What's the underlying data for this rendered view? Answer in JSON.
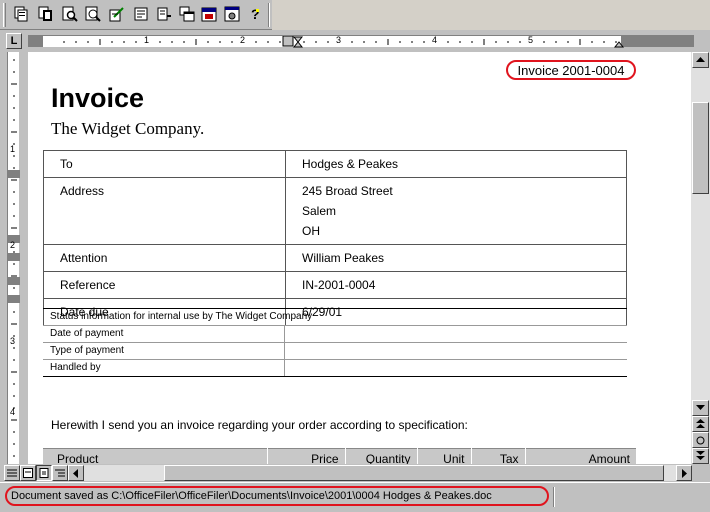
{
  "toolbar": {
    "buttons": [
      "copy-document-icon",
      "new-document-icon",
      "search-document-icon",
      "preview-icon",
      "edit-icon",
      "list-insert-icon",
      "list-remove-icon",
      "copy-window-icon",
      "calendar-icon",
      "settings-icon",
      "help-icon"
    ]
  },
  "ruler": {
    "corner_label": "L",
    "marks": [
      "1",
      "2",
      "3",
      "4",
      "5"
    ],
    "vertical_marks": [
      "1",
      "2",
      "3",
      "4"
    ]
  },
  "document": {
    "invoice_number": "Invoice 2001-0004",
    "title": "Invoice",
    "company": "The Widget Company.",
    "info_rows": [
      {
        "label": "To",
        "value": [
          "Hodges & Peakes"
        ]
      },
      {
        "label": "Address",
        "value": [
          "245 Broad Street",
          "Salem",
          "OH"
        ]
      },
      {
        "label": "Attention",
        "value": [
          "William Peakes"
        ]
      },
      {
        "label": "Reference",
        "value": [
          "IN-2001-0004"
        ]
      },
      {
        "label": "Date due",
        "value": [
          "6/29/01"
        ]
      }
    ],
    "status_header": "Status information for internal use by The Widget Company",
    "status_rows": [
      "Date of payment",
      "Type of payment",
      "Handled by"
    ],
    "intro": "Herewith I send you an invoice regarding your order according to specification:",
    "product_columns": [
      "Product",
      "Price",
      "Quantity",
      "Unit",
      "Tax",
      "Amount"
    ]
  },
  "status_bar": {
    "text": "Document saved as C:\\OfficeFiler\\OfficeFiler\\Documents\\Invoice\\2001\\0004 Hodges & Peakes.doc"
  },
  "colors": {
    "highlight": "#e0141e",
    "chrome": "#c0c0c0"
  }
}
